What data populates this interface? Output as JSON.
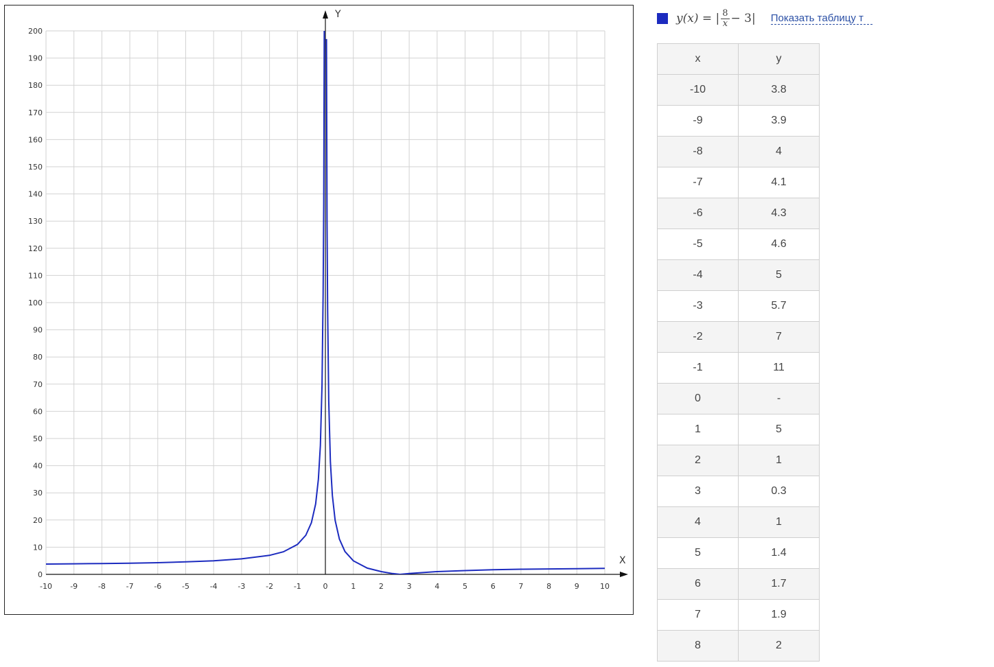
{
  "chart_data": {
    "type": "line",
    "xlabel": "X",
    "ylabel": "Y",
    "xlim": [
      -10,
      10
    ],
    "ylim": [
      0,
      200
    ],
    "grid": true,
    "x_ticks": [
      "-10",
      "-9",
      "-8",
      "-7",
      "-6",
      "-5",
      "-4",
      "-3",
      "-2",
      "-1",
      "0",
      "1",
      "2",
      "3",
      "4",
      "5",
      "6",
      "7",
      "8",
      "9",
      "10"
    ],
    "y_ticks": [
      "0",
      "10",
      "20",
      "30",
      "40",
      "50",
      "60",
      "70",
      "80",
      "90",
      "100",
      "110",
      "120",
      "130",
      "140",
      "150",
      "160",
      "170",
      "180",
      "190",
      "200"
    ],
    "series": [
      {
        "color": "#1c2bbf",
        "x": [
          -10,
          -9,
          -8,
          -7,
          -6,
          -5,
          -4,
          -3,
          -2,
          -1.5,
          -1,
          -0.7,
          -0.5,
          -0.35,
          -0.25,
          -0.18,
          -0.12,
          -0.08,
          -0.06,
          -0.04,
          0.04,
          0.06,
          0.08,
          0.12,
          0.18,
          0.25,
          0.35,
          0.5,
          0.7,
          1,
          1.5,
          2,
          2.4,
          2.67,
          3,
          4,
          5,
          6,
          7,
          8,
          9,
          10
        ],
        "y": [
          3.8,
          3.9,
          4,
          4.1,
          4.3,
          4.6,
          5,
          5.7,
          7,
          8.3,
          11,
          14.4,
          19,
          25.9,
          35,
          47.4,
          69.7,
          103,
          136.3,
          203,
          197,
          130.3,
          97,
          63.7,
          41.4,
          29,
          19.9,
          13,
          8.4,
          5,
          2.3,
          1,
          0.3,
          0,
          0.3,
          1,
          1.4,
          1.7,
          1.9,
          2,
          2.1,
          2.2
        ]
      }
    ]
  },
  "legend": {
    "swatch_color": "#1c2bbf",
    "formula_prefix": "y(x) = |",
    "frac_numerator": "8",
    "frac_denominator": "x",
    "formula_suffix": "− 3|"
  },
  "link": {
    "show_table": "Показать таблицу т"
  },
  "table": {
    "headers": [
      "x",
      "y"
    ],
    "rows": [
      [
        "-10",
        "3.8"
      ],
      [
        "-9",
        "3.9"
      ],
      [
        "-8",
        "4"
      ],
      [
        "-7",
        "4.1"
      ],
      [
        "-6",
        "4.3"
      ],
      [
        "-5",
        "4.6"
      ],
      [
        "-4",
        "5"
      ],
      [
        "-3",
        "5.7"
      ],
      [
        "-2",
        "7"
      ],
      [
        "-1",
        "11"
      ],
      [
        "0",
        "-"
      ],
      [
        "1",
        "5"
      ],
      [
        "2",
        "1"
      ],
      [
        "3",
        "0.3"
      ],
      [
        "4",
        "1"
      ],
      [
        "5",
        "1.4"
      ],
      [
        "6",
        "1.7"
      ],
      [
        "7",
        "1.9"
      ],
      [
        "8",
        "2"
      ]
    ]
  }
}
